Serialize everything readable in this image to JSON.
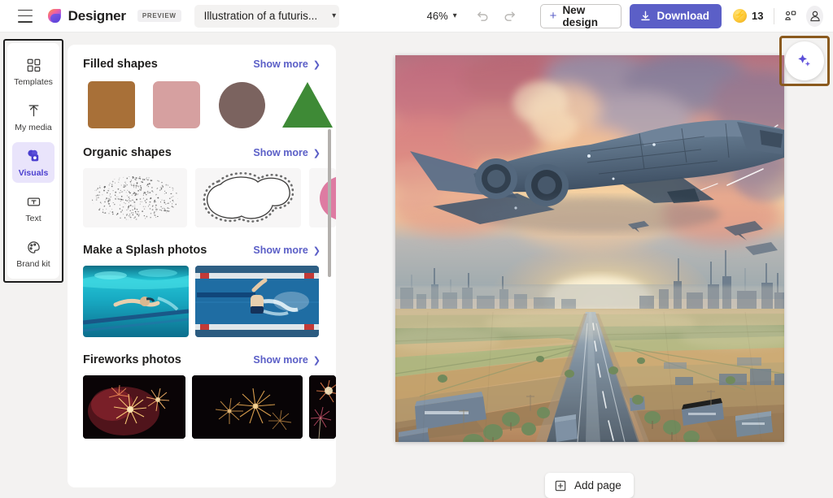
{
  "header": {
    "menu_icon": "hamburger-icon",
    "brand": "Designer",
    "preview_badge": "PREVIEW",
    "document_title": "Illustration of a futuris...",
    "title_chevron": "chevron-down-icon",
    "zoom_level": "46%",
    "undo_icon": "undo-arrow-icon",
    "redo_icon": "redo-arrow-icon",
    "new_design_label": "New design",
    "new_design_plus": "+",
    "download_label": "Download",
    "download_icon": "download-arrow-icon",
    "credits_count": "13",
    "credits_icon": "lightning-coin-icon",
    "share_icon": "share-nodes-icon",
    "account_icon": "account-person-icon",
    "accent_color": "#5b5fc7",
    "coin_color": "#fdc838"
  },
  "sidebar": {
    "items": [
      {
        "label": "Templates",
        "icon": "templates-grid-icon",
        "active": false
      },
      {
        "label": "My media",
        "icon": "upload-arrow-icon",
        "active": false
      },
      {
        "label": "Visuals",
        "icon": "visuals-shapes-icon",
        "active": true
      },
      {
        "label": "Text",
        "icon": "text-box-icon",
        "active": false
      },
      {
        "label": "Brand kit",
        "icon": "palette-icon",
        "active": false
      }
    ],
    "active_background": "#e9e4fb",
    "active_text_color": "#4b3fcf",
    "highlight_border_color": "#1b1b1b"
  },
  "panel": {
    "show_more_label": "Show more",
    "show_more_chevron": "chevron-right-icon",
    "sections": [
      {
        "title": "Filled shapes",
        "kind": "shapes",
        "items": [
          {
            "name": "brown-square-shape",
            "color": "#a87038"
          },
          {
            "name": "rose-rounded-square-shape",
            "color": "#d6a0a0"
          },
          {
            "name": "mauve-circle-shape",
            "color": "#7b635f"
          },
          {
            "name": "green-triangle-shape",
            "color": "#3e8a36"
          }
        ]
      },
      {
        "title": "Organic shapes",
        "kind": "organic",
        "items": [
          {
            "name": "stippled-blob-shape"
          },
          {
            "name": "dotted-outline-blob-shape"
          },
          {
            "name": "pink-organic-shape",
            "color": "#e0779e"
          }
        ]
      },
      {
        "title": "Make a Splash photos",
        "kind": "photos",
        "items": [
          {
            "name": "underwater-swimmer-photo"
          },
          {
            "name": "overhead-swimming-pool-photo"
          }
        ]
      },
      {
        "title": "Fireworks photos",
        "kind": "photos",
        "items": [
          {
            "name": "red-firework-burst-photo"
          },
          {
            "name": "golden-fireworks-photo"
          },
          {
            "name": "firework-trail-photo"
          }
        ]
      }
    ],
    "scrollbar": "vertical-scrollbar"
  },
  "canvas": {
    "artwork_name": "futuristic-spacecraft-watercolor-illustration",
    "description": "Watercolor illustration of a futuristic spacecraft flying over farmland toward a distant sci-fi city at sunset",
    "sky_colors": [
      "#c8687a",
      "#e8a徒",
      "#f3c795",
      "#7e94b8"
    ],
    "ai_button_icon": "sparkle-icon",
    "ai_highlight_border_color": "#8a5a1e"
  },
  "footer": {
    "add_page_label": "Add page",
    "add_page_icon": "plus-square-icon"
  }
}
